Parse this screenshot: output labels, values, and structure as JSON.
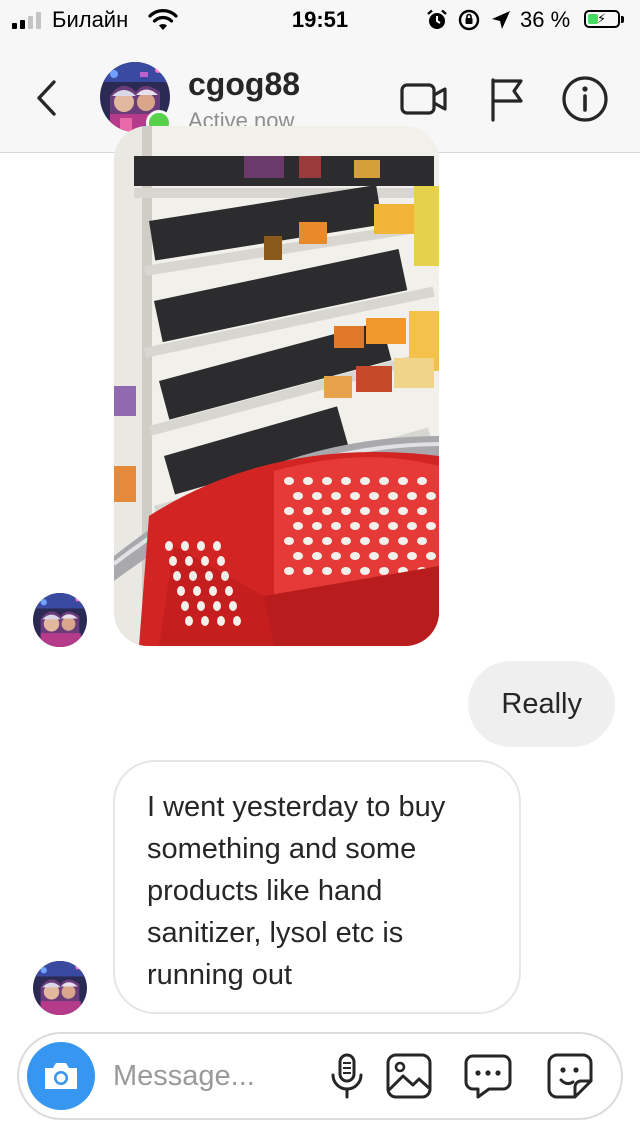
{
  "status_bar": {
    "carrier": "Билайн",
    "time": "19:51",
    "battery_percent": "36 %",
    "battery_level": 0.36
  },
  "header": {
    "username": "cgog88",
    "presence": "Active now",
    "icons": [
      "back-chevron",
      "video-camera",
      "flag",
      "info"
    ]
  },
  "messages": [
    {
      "type": "photo",
      "sender": "cgog88",
      "description_icon": "photo"
    },
    {
      "type": "text",
      "sender": "me",
      "text": "Really"
    },
    {
      "type": "text",
      "sender": "cgog88",
      "text": "I went yesterday to buy something and some products like hand sanitizer,  lysol etc is running out"
    }
  ],
  "composer": {
    "placeholder": "Message...",
    "icons": [
      "camera",
      "microphone",
      "gallery",
      "message-options",
      "sticker"
    ]
  },
  "colors": {
    "accent": "#3797f0",
    "online": "#57d04a",
    "sent_bubble": "#efefef"
  }
}
